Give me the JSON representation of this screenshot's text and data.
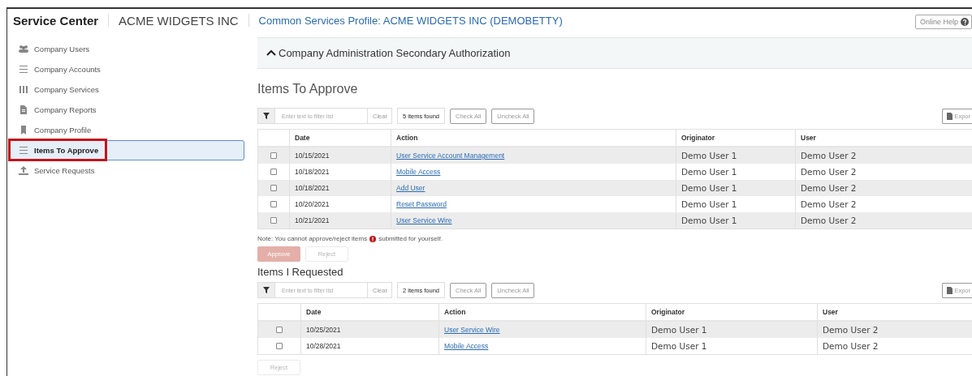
{
  "header": {
    "title": "Service Center",
    "company": "ACME WIDGETS INC",
    "profile": "Common Services Profile: ACME WIDGETS INC (DEMOBETTY)",
    "help_button": "Online Help"
  },
  "sidebar": {
    "items": [
      {
        "label": "Company Users",
        "selected": false
      },
      {
        "label": "Company Accounts",
        "selected": false
      },
      {
        "label": "Company Services",
        "selected": false
      },
      {
        "label": "Company Reports",
        "selected": false
      },
      {
        "label": "Company Profile",
        "selected": false
      },
      {
        "label": "Items To Approve",
        "selected": true
      },
      {
        "label": "Service Requests",
        "selected": false
      }
    ]
  },
  "panel": {
    "title": "Company Administration Secondary Authorization",
    "expanded": true
  },
  "sections": [
    {
      "heading": "Items To Approve",
      "filter_placeholder": "Enter text to filter list",
      "clear": "Clear",
      "count": "5 items found",
      "check_all": "Check All",
      "uncheck_all": "Uncheck All",
      "export": "Expor",
      "columns": [
        "Date",
        "Action",
        "Originator",
        "User"
      ],
      "rows": [
        {
          "checked": false,
          "date": "10/15/2021",
          "action": "User Service Account Management",
          "originator": "Demo User 1",
          "user": "Demo User 2"
        },
        {
          "checked": false,
          "date": "10/18/2021",
          "action": "Mobile Access",
          "originator": "Demo User 1",
          "user": "Demo User 2"
        },
        {
          "checked": false,
          "date": "10/18/2021",
          "action": "Add User",
          "originator": "Demo User 1",
          "user": "Demo User 2"
        },
        {
          "checked": false,
          "date": "10/20/2021",
          "action": "Reset Password",
          "originator": "Demo User 1",
          "user": "Demo User 2"
        },
        {
          "checked": false,
          "date": "10/21/2021",
          "action": "User Service Wire",
          "originator": "Demo User 1",
          "user": "Demo User 2"
        }
      ],
      "note": [
        "Note: You cannot approve/reject items",
        "submitted for yourself."
      ],
      "buttons": [
        {
          "label": "Approve",
          "kind": "primary",
          "disabled": true
        },
        {
          "label": "Reject",
          "kind": "secondary",
          "disabled": true
        }
      ]
    },
    {
      "heading": "Items I Requested",
      "filter_placeholder": "Enter text to filter list",
      "clear": "Clear",
      "count": "2 items found",
      "check_all": "Check All",
      "uncheck_all": "Uncheck All",
      "export": "Expor",
      "columns": [
        "Date",
        "Action",
        "Originator",
        "User"
      ],
      "rows": [
        {
          "checked": false,
          "date": "10/25/2021",
          "action": "User Service Wire",
          "originator": "Demo User 1",
          "user": "Demo User 2"
        },
        {
          "checked": false,
          "date": "10/28/2021",
          "action": "Mobile Access",
          "originator": "Demo User 1",
          "user": "Demo User 2"
        }
      ],
      "buttons": [
        {
          "label": "Reject",
          "kind": "secondary",
          "disabled": true
        }
      ]
    }
  ]
}
